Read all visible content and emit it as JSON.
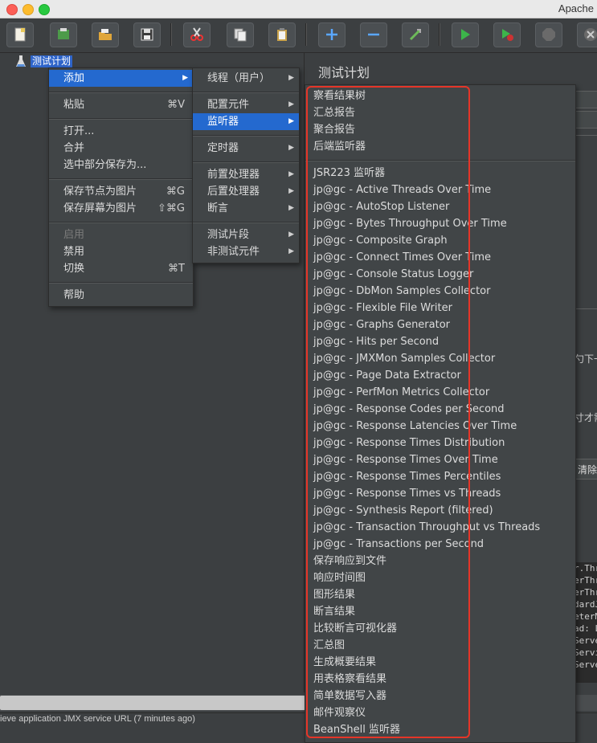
{
  "window": {
    "title": "Apache"
  },
  "toolbar": {
    "buttons": [
      "new-icon",
      "templates-icon",
      "open-icon",
      "save-icon",
      "cut-icon",
      "copy-icon",
      "paste-icon",
      "expand-icon",
      "collapse-icon",
      "toggle-icon",
      "start-icon",
      "start-no-pause-icon",
      "stop-icon",
      "shutdown-icon"
    ]
  },
  "tree": {
    "root_label": "测试计划"
  },
  "right_panel": {
    "title": "测试计划",
    "edge_text_1": "勺下一",
    "edge_text_2": "寸才需",
    "clear_button": "清除"
  },
  "console_lines": [
    "r.Thr",
    "erThr",
    "erThr",
    "dardJ",
    "eterM",
    "ad: L",
    "Serve",
    "Servi",
    "Serve"
  ],
  "status_bar": {
    "text": "ieve application JMX service URL (7 minutes ago)"
  },
  "context_menu": {
    "items": [
      {
        "label": "添加",
        "shortcut": "",
        "submenu": true,
        "selected": true,
        "disabled": false
      },
      {
        "label": "粘贴",
        "shortcut": "⌘V",
        "submenu": false,
        "selected": false,
        "disabled": false
      },
      {
        "label": "打开...",
        "shortcut": "",
        "submenu": false,
        "selected": false,
        "disabled": false
      },
      {
        "label": "合并",
        "shortcut": "",
        "submenu": false,
        "selected": false,
        "disabled": false
      },
      {
        "label": "选中部分保存为...",
        "shortcut": "",
        "submenu": false,
        "selected": false,
        "disabled": false
      },
      {
        "label": "保存节点为图片",
        "shortcut": "⌘G",
        "submenu": false,
        "selected": false,
        "disabled": false
      },
      {
        "label": "保存屏幕为图片",
        "shortcut": "⇧⌘G",
        "submenu": false,
        "selected": false,
        "disabled": false
      },
      {
        "label": "启用",
        "shortcut": "",
        "submenu": false,
        "selected": false,
        "disabled": true
      },
      {
        "label": "禁用",
        "shortcut": "",
        "submenu": false,
        "selected": false,
        "disabled": false
      },
      {
        "label": "切换",
        "shortcut": "⌘T",
        "submenu": false,
        "selected": false,
        "disabled": false
      },
      {
        "label": "帮助",
        "shortcut": "",
        "submenu": false,
        "selected": false,
        "disabled": false
      }
    ]
  },
  "add_submenu": {
    "items": [
      {
        "label": "线程（用户）",
        "selected": false
      },
      {
        "label": "配置元件",
        "selected": false
      },
      {
        "label": "监听器",
        "selected": true
      },
      {
        "label": "定时器",
        "selected": false
      },
      {
        "label": "前置处理器",
        "selected": false
      },
      {
        "label": "后置处理器",
        "selected": false
      },
      {
        "label": "断言",
        "selected": false
      },
      {
        "label": "测试片段",
        "selected": false
      },
      {
        "label": "非测试元件",
        "selected": false
      }
    ]
  },
  "listener_submenu": {
    "items": [
      "察看结果树",
      "汇总报告",
      "聚合报告",
      "后端监听器",
      "JSR223 监听器",
      "jp@gc - Active Threads Over Time",
      "jp@gc - AutoStop Listener",
      "jp@gc - Bytes Throughput Over Time",
      "jp@gc - Composite Graph",
      "jp@gc - Connect Times Over Time",
      "jp@gc - Console Status Logger",
      "jp@gc - DbMon Samples Collector",
      "jp@gc - Flexible File Writer",
      "jp@gc - Graphs Generator",
      "jp@gc - Hits per Second",
      "jp@gc - JMXMon Samples Collector",
      "jp@gc - Page Data Extractor",
      "jp@gc - PerfMon Metrics Collector",
      "jp@gc - Response Codes per Second",
      "jp@gc - Response Latencies Over Time",
      "jp@gc - Response Times Distribution",
      "jp@gc - Response Times Over Time",
      "jp@gc - Response Times Percentiles",
      "jp@gc - Response Times vs Threads",
      "jp@gc - Synthesis Report (filtered)",
      "jp@gc - Transaction Throughput vs Threads",
      "jp@gc - Transactions per Second",
      "保存响应到文件",
      "响应时间图",
      "图形结果",
      "断言结果",
      "比较断言可视化器",
      "汇总图",
      "生成概要结果",
      "用表格察看结果",
      "简单数据写入器",
      "邮件观察仪",
      "BeanShell 监听器"
    ]
  },
  "colors": {
    "highlight": "#2469cf",
    "annotation": "#e53528"
  }
}
